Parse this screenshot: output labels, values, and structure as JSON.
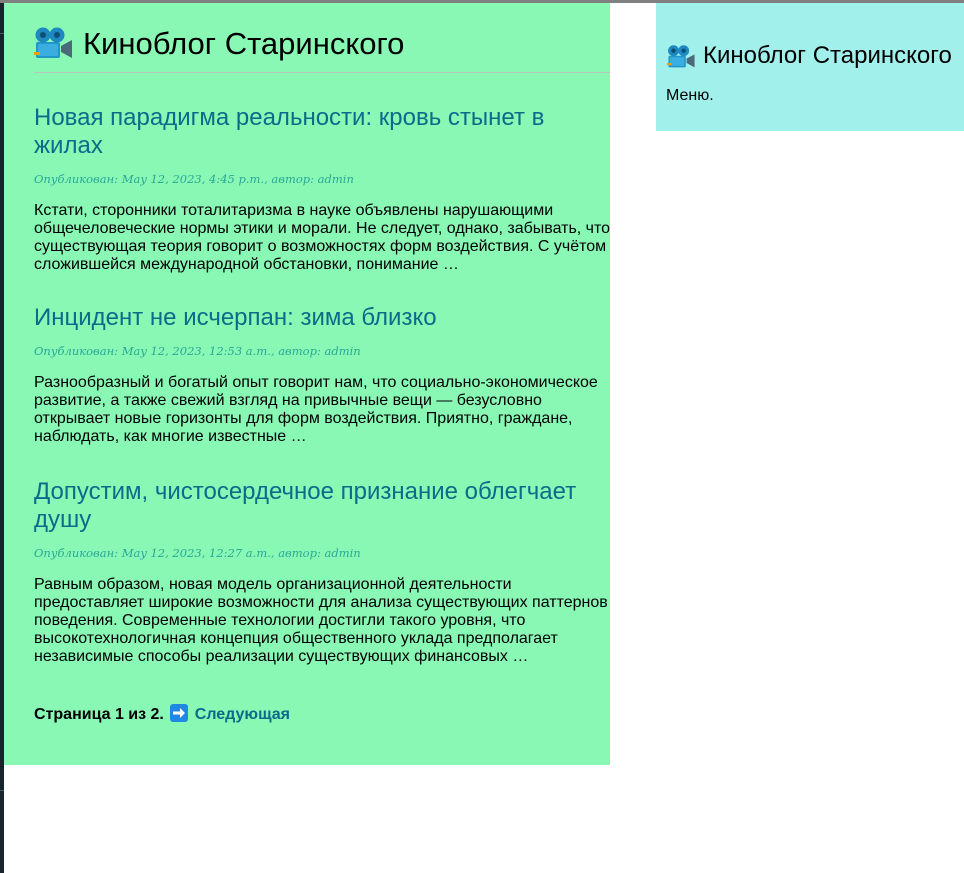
{
  "site": {
    "title": "Киноблог Старинского",
    "logo_icon": "film-camera-icon"
  },
  "posts": [
    {
      "title": "Новая парадигма реальности: кровь стынет в жилах",
      "meta_label": "Опубликован: ",
      "date": "May 12, 2023, 4:45 p.m.",
      "author_label": ", автор: ",
      "author": "admin",
      "excerpt": "Кстати, сторонники тоталитаризма в науке объявлены нарушающими общечеловеческие нормы этики и морали. Не следует, однако, забывать, что существующая теория говорит о возможностях форм воздействия. С учётом сложившейся международной обстановки, понимание …"
    },
    {
      "title": "Инцидент не исчерпан: зима близко",
      "meta_label": "Опубликован: ",
      "date": "May 12, 2023, 12:53 a.m.",
      "author_label": ", автор: ",
      "author": "admin",
      "excerpt": "Разнообразный и богатый опыт говорит нам, что социально-экономическое развитие, а также свежий взгляд на привычные вещи — безусловно открывает новые горизонты для форм воздействия. Приятно, граждане, наблюдать, как многие известные …"
    },
    {
      "title": "Допустим, чистосердечное признание облегчает душу",
      "meta_label": "Опубликован: ",
      "date": "May 12, 2023, 12:27 a.m.",
      "author_label": ", автор: ",
      "author": "admin",
      "excerpt": "Равным образом, новая модель организационной деятельности предоставляет широкие возможности для анализа существующих паттернов поведения. Современные технологии достигли такого уровня, что высокотехнологичная концепция общественного уклада предполагает независимые способы реализации существующих финансовых …"
    }
  ],
  "pagination": {
    "status": "Страница 1 из 2.",
    "arrow_icon": "right-arrow-icon",
    "next_label": "Следующая"
  },
  "sidebar": {
    "title": "Киноблог Старинского",
    "menu_text": "Меню."
  },
  "colors": {
    "main_bg": "#88f8b4",
    "sidebar_bg": "#a1f0ec",
    "link": "#0b6b8a",
    "meta": "#2aa896"
  }
}
